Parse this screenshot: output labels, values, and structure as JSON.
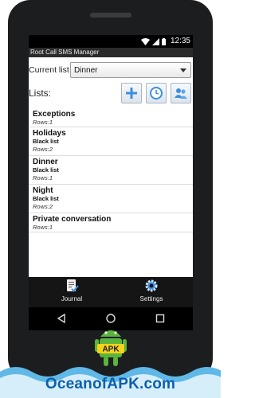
{
  "status_bar": {
    "time": "12:35"
  },
  "app": {
    "title": "Root Call SMS Manager"
  },
  "current_list": {
    "label": "Current list",
    "value": "Dinner"
  },
  "lists": {
    "label": "Lists:",
    "items": [
      {
        "name": "Exceptions",
        "type": "",
        "rows": "Rows:1"
      },
      {
        "name": "Holidays",
        "type": "Black list",
        "rows": "Rows:2"
      },
      {
        "name": "Dinner",
        "type": "Black list",
        "rows": "Rows:1"
      },
      {
        "name": "Night",
        "type": "Black list",
        "rows": "Rows:2"
      },
      {
        "name": "Private conversation",
        "type": "",
        "rows": "Rows:1"
      }
    ]
  },
  "toolbar": {
    "add_icon": "plus-icon",
    "clock_icon": "clock-icon",
    "contacts_icon": "contacts-icon"
  },
  "bottom_nav": {
    "journal_label": "Journal",
    "settings_label": "Settings"
  },
  "watermark": {
    "text": "OceanofAPK.com",
    "badge": "APK"
  },
  "colors": {
    "accent_blue": "#3d8fdc",
    "title_bar": "#2b2b2b",
    "nav_bar": "#151515",
    "brand": "#0d5fae"
  }
}
